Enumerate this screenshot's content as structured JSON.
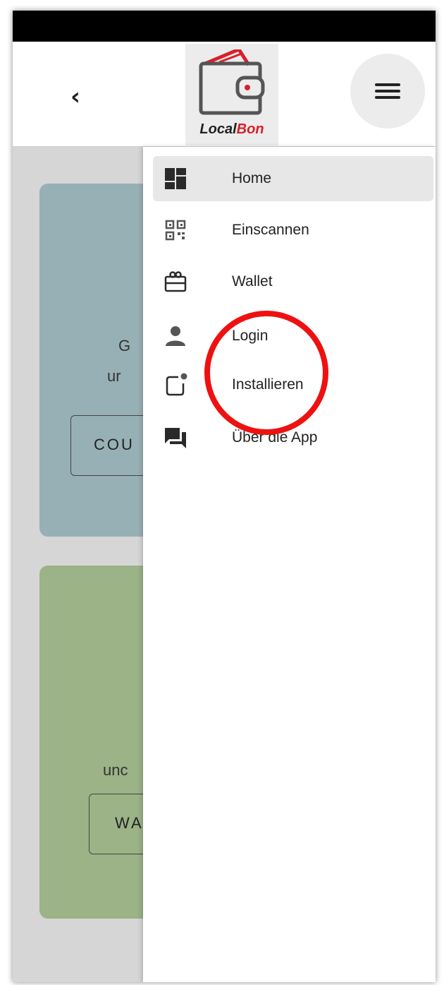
{
  "app": {
    "logo_text_part1": "Local",
    "logo_text_part2": "Bon",
    "back_glyph": "‹",
    "accent_color": "#d8202a"
  },
  "background": {
    "card1": {
      "text_line1": "G",
      "text_line2": "ur",
      "button_label": "COU"
    },
    "card2": {
      "text_line1": "unc",
      "button_label": "WA"
    }
  },
  "drawer": {
    "items": [
      {
        "label": "Home",
        "icon": "dashboard-icon",
        "active": true
      },
      {
        "label": "Einscannen",
        "icon": "qr-code-icon",
        "active": false
      },
      {
        "label": "Wallet",
        "icon": "gift-card-icon",
        "active": false
      },
      {
        "label": "Login",
        "icon": "person-icon",
        "active": false
      },
      {
        "label": "Installieren",
        "icon": "install-app-icon",
        "active": false
      },
      {
        "label": "Über die App",
        "icon": "chat-icon",
        "active": false
      }
    ]
  },
  "annotation": {
    "color": "#ee1111",
    "target": "Installieren"
  }
}
